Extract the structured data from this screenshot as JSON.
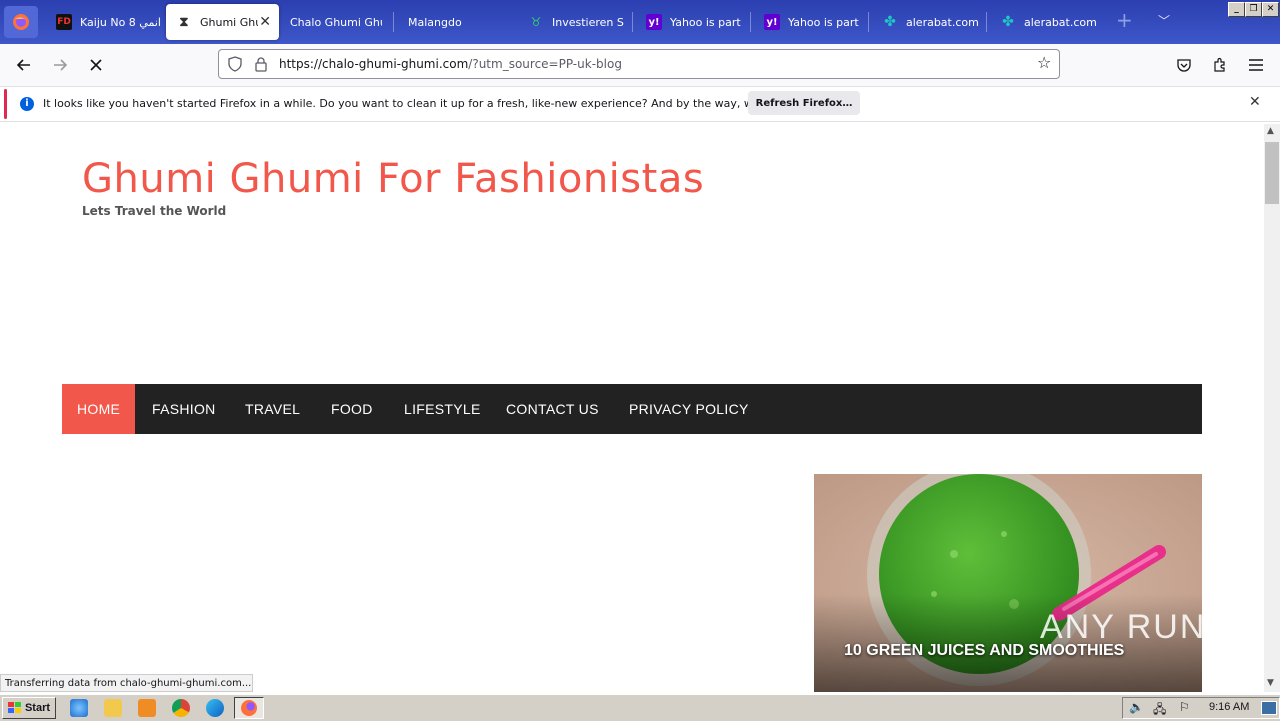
{
  "browser": {
    "tabs": [
      {
        "title": "Kaiju No 8 انمي",
        "icon": "fd-icon",
        "active": false
      },
      {
        "title": "Ghumi Ghumi",
        "icon": "hourglass-icon",
        "active": true
      },
      {
        "title": "Chalo Ghumi Ghumi",
        "icon": "",
        "active": false
      },
      {
        "title": "Malangdo",
        "icon": "",
        "active": false
      },
      {
        "title": "Investieren Sie",
        "icon": "bull-icon",
        "active": false
      },
      {
        "title": "Yahoo is part of",
        "icon": "yahoo-icon",
        "active": false
      },
      {
        "title": "Yahoo is part of",
        "icon": "yahoo-icon",
        "active": false
      },
      {
        "title": "alerabat.com |",
        "icon": "alerabat-icon",
        "active": false
      },
      {
        "title": "alerabat.com |",
        "icon": "alerabat-icon",
        "active": false
      }
    ],
    "url_host": "https://chalo-ghumi-ghumi.com",
    "url_rest": "/?utm_source=PP-uk-blog"
  },
  "notification": {
    "message": "It looks like you haven't started Firefox in a while. Do you want to clean it up for a fresh, like-new experience? And by the way, welcome back!",
    "button": "Refresh Firefox…"
  },
  "site": {
    "title": "Ghumi Ghumi For Fashionistas",
    "tagline": "Lets Travel the World",
    "menu": [
      "HOME",
      "FASHION",
      "TRAVEL",
      "FOOD",
      "LIFESTYLE",
      "CONTACT US",
      "PRIVACY POLICY"
    ],
    "featured_caption": "10 GREEN JUICES AND SMOOTHIES",
    "watermark": "ANY RUN"
  },
  "status_text": "Transferring data from chalo-ghumi-ghumi.com...",
  "taskbar": {
    "start": "Start",
    "clock": "9:16 AM"
  },
  "colors": {
    "accent": "#f1574a",
    "menu_bg": "#222222",
    "tabstrip": "#3a50c2"
  }
}
